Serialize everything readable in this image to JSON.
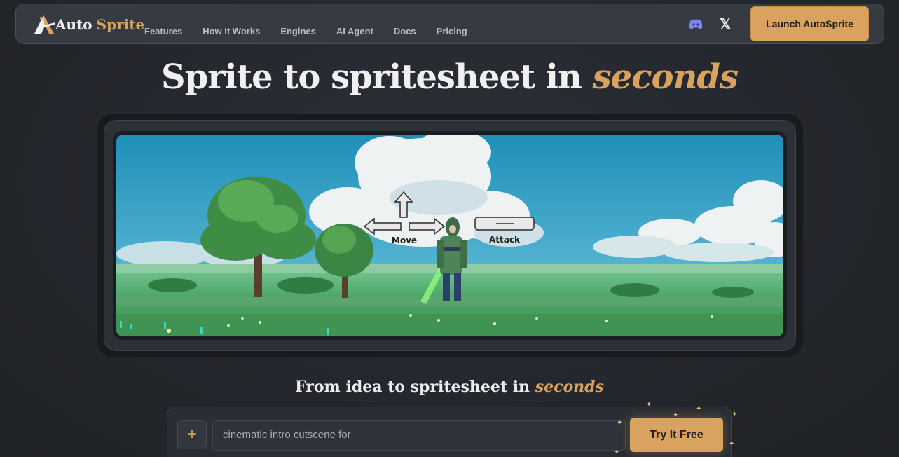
{
  "nav": {
    "logo_auto": "Auto",
    "logo_sprite": "Sprite",
    "links": [
      "Features",
      "How It Works",
      "Engines",
      "AI Agent",
      "Docs",
      "Pricing"
    ],
    "discord_icon": "discord-icon",
    "x_icon": "x-logo-icon",
    "x_glyph": "𝕏",
    "launch_label": "Launch AutoSprite"
  },
  "hero": {
    "title_main": "Sprite to spritesheet in ",
    "title_accent": "seconds"
  },
  "scene": {
    "move_label": "Move",
    "attack_label": "Attack"
  },
  "prompt_section": {
    "title_main": "From idea to spritesheet in ",
    "title_accent": "seconds",
    "plus_glyph": "+",
    "input_value": "cinematic intro cutscene for",
    "cta_label": "Try It Free"
  },
  "colors": {
    "accent": "#d9a35f",
    "background": "#24272d",
    "nav_bg": "#363a41"
  }
}
